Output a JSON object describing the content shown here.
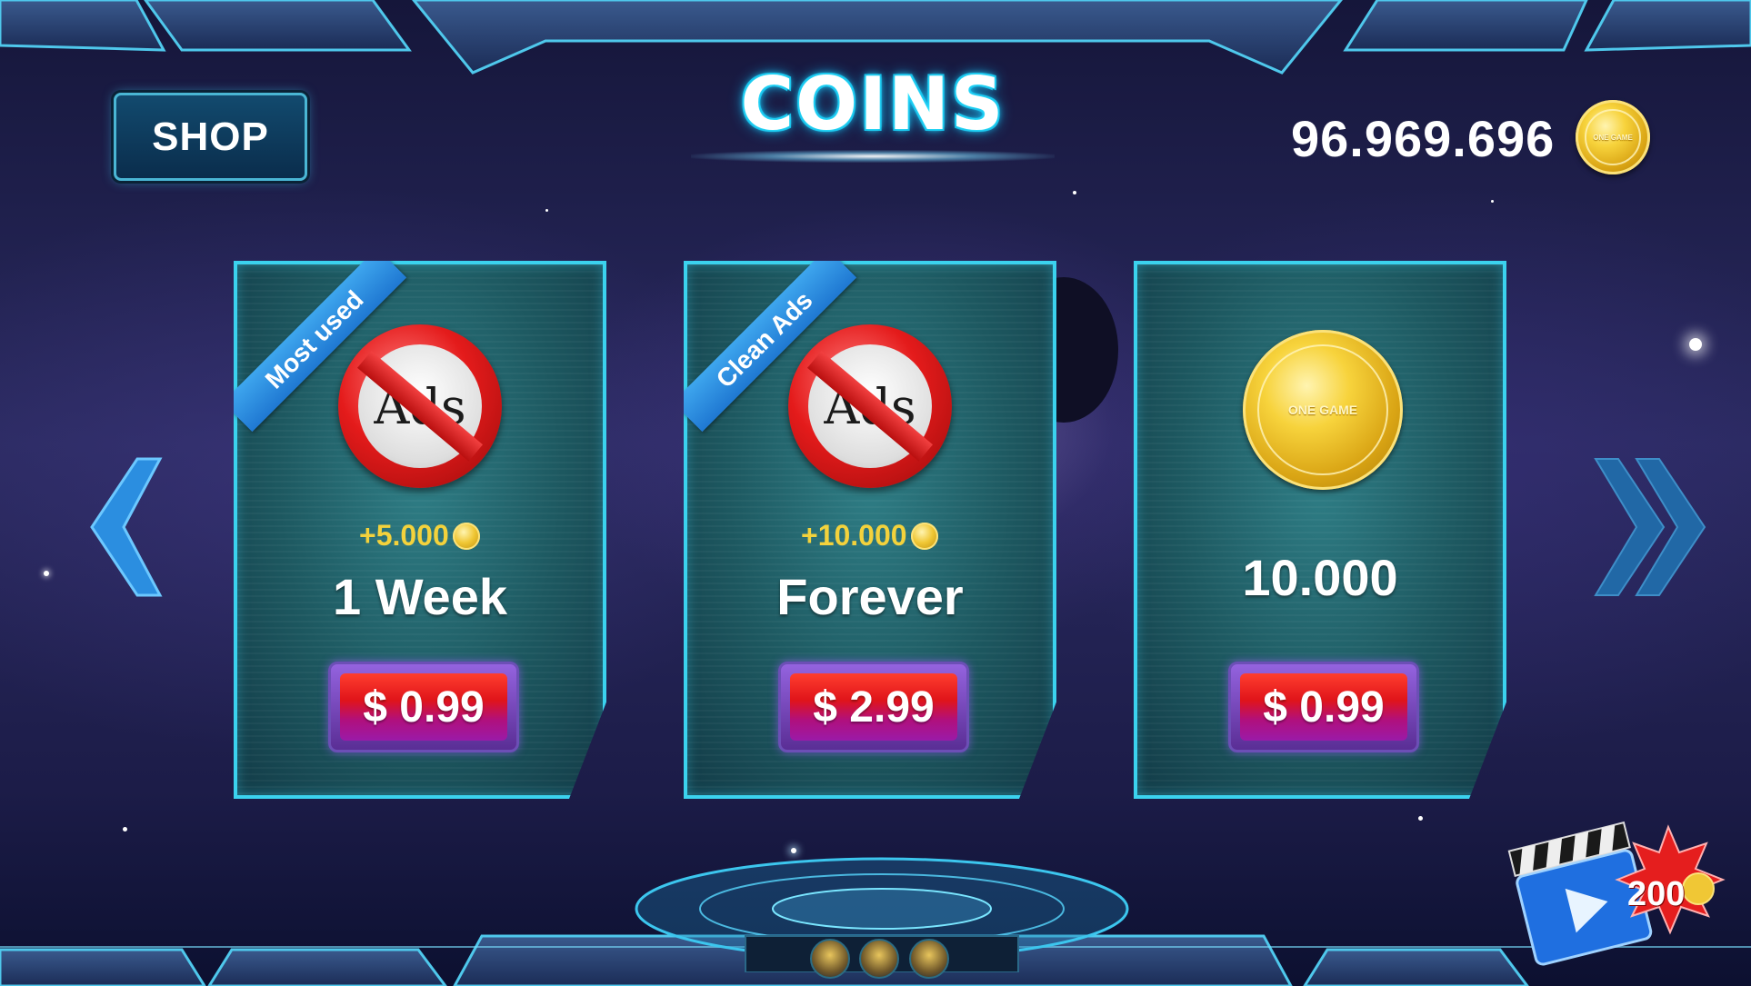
{
  "header": {
    "shop_label": "SHOP",
    "title": "COINS",
    "balance": "96.969.696",
    "balance_coin_text": "ONE GAME"
  },
  "cards": [
    {
      "ribbon": "Most used",
      "icon": "no-ads-icon",
      "icon_text": "Ads",
      "bonus": "+5.000",
      "label": "1 Week",
      "price": "$ 0.99"
    },
    {
      "ribbon": "Clean Ads",
      "icon": "no-ads-icon",
      "icon_text": "Ads",
      "bonus": "+10.000",
      "label": "Forever",
      "price": "$ 2.99"
    },
    {
      "icon": "gold-coin-icon",
      "icon_text": "ONE GAME",
      "label": "10.000",
      "price": "$ 0.99"
    }
  ],
  "nav": {
    "prev_icon": "chevron-left-icon",
    "next_icon": "double-chevron-right-icon"
  },
  "video_reward": {
    "icon": "clapperboard-play-icon",
    "amount": "200"
  },
  "colors": {
    "accent_cyan": "#3bd2ee",
    "price_red": "#e0141a",
    "price_purple": "#9b1aa8",
    "coin_gold": "#f0c735",
    "ribbon_blue": "#2a8fe0"
  }
}
